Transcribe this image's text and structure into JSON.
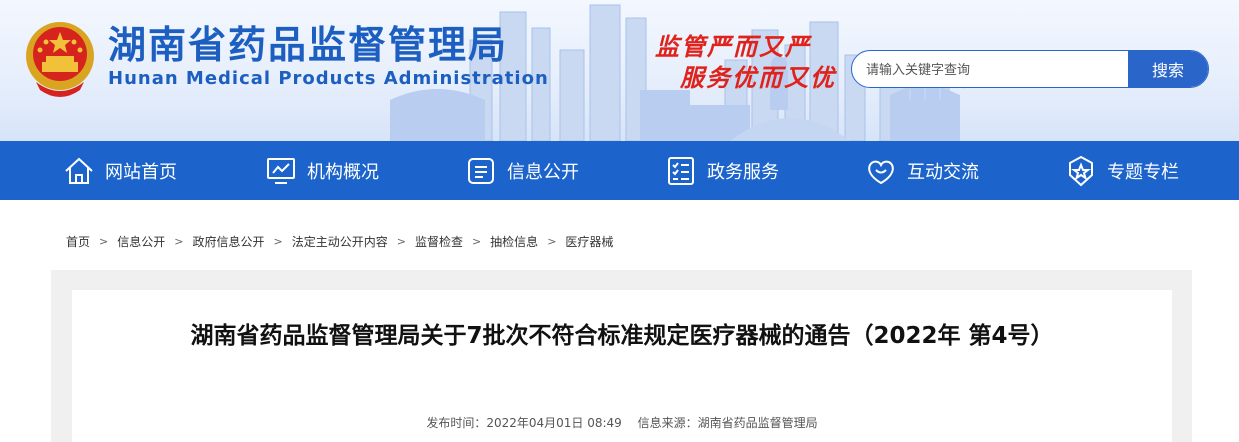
{
  "header": {
    "title": "湖南省药品监督管理局",
    "subtitle": "Hunan Medical Products Administration",
    "slogan_line1": "监管严而又严",
    "slogan_line2": "服务优而又优"
  },
  "search": {
    "placeholder": "请输入关键字查询",
    "button_label": "搜索"
  },
  "nav": {
    "items": [
      {
        "label": "网站首页",
        "icon": "home-icon"
      },
      {
        "label": "机构概况",
        "icon": "monitor-chart-icon"
      },
      {
        "label": "信息公开",
        "icon": "document-list-icon"
      },
      {
        "label": "政务服务",
        "icon": "checklist-icon"
      },
      {
        "label": "互动交流",
        "icon": "heart-chat-icon"
      },
      {
        "label": "专题专栏",
        "icon": "star-badge-icon"
      }
    ]
  },
  "breadcrumb": {
    "separator": ">",
    "items": [
      "首页",
      "信息公开",
      "政府信息公开",
      "法定主动公开内容",
      "监督检查",
      "抽检信息",
      "医疗器械"
    ]
  },
  "article": {
    "title": "湖南省药品监督管理局关于7批次不符合标准规定医疗器械的通告（2022年 第4号）",
    "publish_label": "发布时间：",
    "publish_time": "2022年04月01日 08:49",
    "source_label": "信息来源：",
    "source": "湖南省药品监督管理局"
  },
  "colors": {
    "primary_blue": "#1c64cb",
    "title_blue": "#1c5fc0",
    "slogan_red": "#e0221c"
  }
}
